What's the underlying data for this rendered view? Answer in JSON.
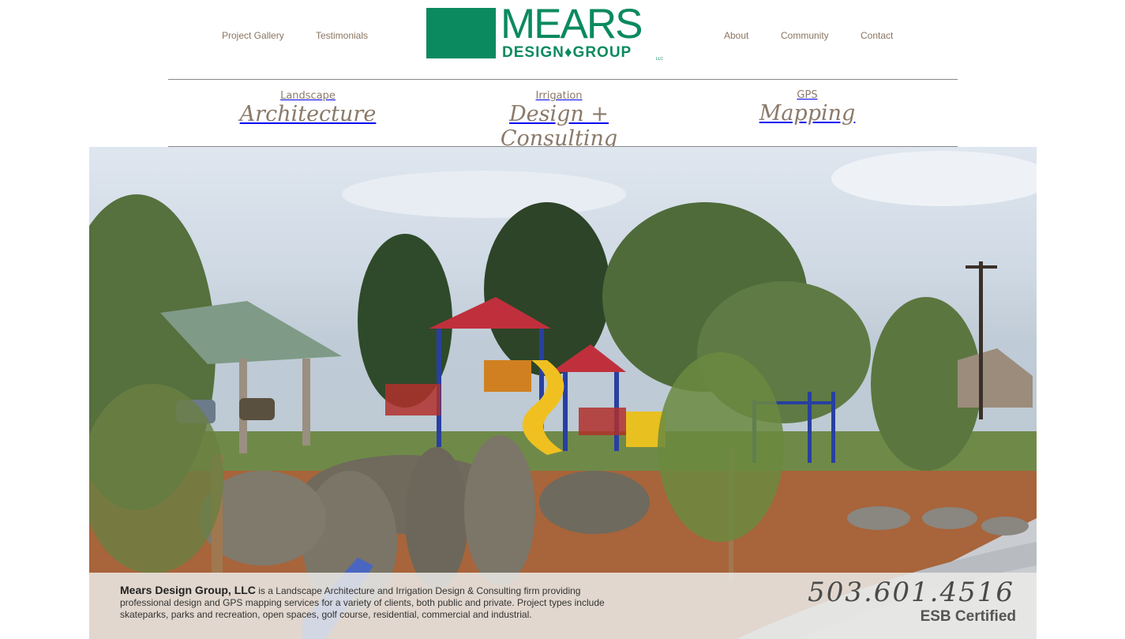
{
  "nav": {
    "left": [
      "Project Gallery",
      "Testimonials"
    ],
    "right": [
      "About",
      "Community",
      "Contact"
    ]
  },
  "logo": {
    "word": "MEARS",
    "sub": "DESIGN♦GROUP",
    "llc": "LLC"
  },
  "services": [
    {
      "small": "Landscape",
      "script": "Architecture"
    },
    {
      "small": "Irrigation",
      "script": "Design + Consulting"
    },
    {
      "small": "GPS",
      "script": "Mapping"
    }
  ],
  "caption": {
    "company": "Mears Design Group, LLC",
    "description": " is a Landscape Architecture and Irrigation Design & Consulting firm providing professional design and GPS mapping services for a variety of clients, both public and private. Project types include skateparks, parks and recreation, open spaces, golf course, residential, commercial and industrial.",
    "phone": "503.601.4516",
    "certification": "ESB Certified"
  },
  "colors": {
    "brand_green": "#0a8a5e",
    "nav_text": "#8a7560"
  }
}
